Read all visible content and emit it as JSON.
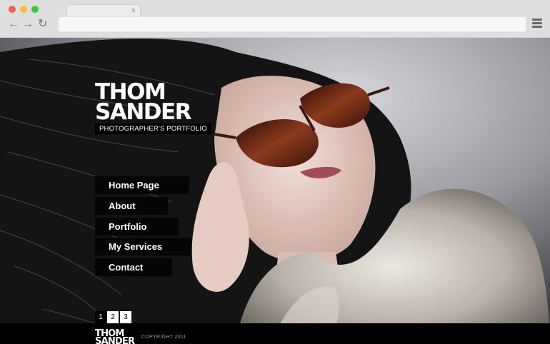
{
  "browser": {
    "traffic_lights": [
      "#f25f58",
      "#fbbe2e",
      "#39c93f"
    ],
    "tab_close": "×",
    "back_icon": "←",
    "forward_icon": "→",
    "reload_icon": "↻",
    "menu_icon": "hamburger-icon"
  },
  "site": {
    "logo_line1": "THOM",
    "logo_line2": "SANDER",
    "tagline": "PHOTOGRAPHER'S PORTFOLIO",
    "nav": [
      {
        "label": "Home Page"
      },
      {
        "label": "About"
      },
      {
        "label": "Portfolio"
      },
      {
        "label": "My Services"
      },
      {
        "label": "Contact"
      }
    ],
    "pagination": [
      "1",
      "2",
      "3"
    ],
    "footer_logo_line1": "THOM",
    "footer_logo_line2": "SANDER",
    "copyright": "COPYRIGHT 2011"
  }
}
